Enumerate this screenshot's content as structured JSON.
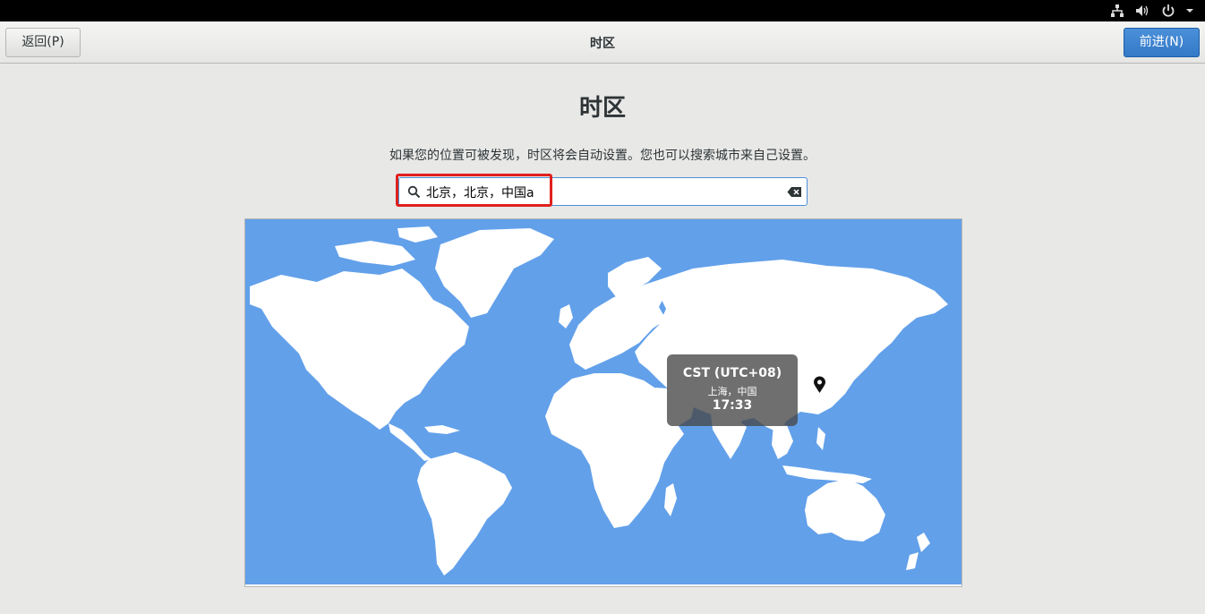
{
  "header": {
    "back_label": "返回(P)",
    "title": "时区",
    "next_label": "前进(N)"
  },
  "system_tray": {
    "icons": [
      "network-icon",
      "volume-icon",
      "power-icon",
      "chevron-down-icon"
    ]
  },
  "main": {
    "title": "时区",
    "description": "如果您的位置可被发现，时区将会自动设置。您也可以搜索城市来自己设置。",
    "search": {
      "value": "北京，北京，中国a",
      "icon": "search-icon",
      "clear_icon": "clear-icon"
    }
  },
  "map": {
    "ocean_color": "#62a0ea",
    "land_color": "#ffffff",
    "tooltip": {
      "abbreviation": "CST (UTC+08)",
      "city": "上海，中国",
      "time": "17:33"
    }
  },
  "colors": {
    "accent": "#3584e4",
    "highlight_border": "#e0201c"
  }
}
